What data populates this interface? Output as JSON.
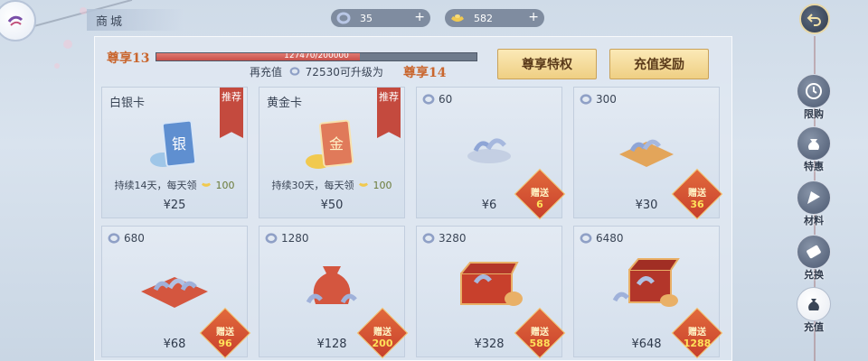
{
  "header": {
    "shop_title": "商城",
    "currencies": [
      {
        "name": "jade-ring-icon",
        "value": "35",
        "add_label": "+"
      },
      {
        "name": "gold-ingot-icon",
        "value": "582",
        "add_label": "+"
      }
    ]
  },
  "vip": {
    "current_level": "尊享13",
    "next_level": "尊享14",
    "progress_text": "127470/200000",
    "progress_fraction": 0.637,
    "recharge_prefix": "再充值",
    "recharge_amount": "72530",
    "recharge_suffix": "可升级为",
    "privilege_button": "尊享特权",
    "reward_button": "充值奖励"
  },
  "cards": [
    {
      "title": "白银卡",
      "tag": "推荐",
      "art_char": "银",
      "desc_prefix": "持续14天，每天领",
      "desc_value": "100",
      "price": "¥25"
    },
    {
      "title": "黄金卡",
      "tag": "推荐",
      "art_char": "金",
      "desc_prefix": "持续30天，每天领",
      "desc_value": "100",
      "price": "¥50"
    },
    {
      "amount": "60",
      "price": "¥6",
      "gift_label": "赠送",
      "gift_value": "6"
    },
    {
      "amount": "300",
      "price": "¥30",
      "gift_label": "赠送",
      "gift_value": "36"
    },
    {
      "amount": "680",
      "price": "¥68",
      "gift_label": "赠送",
      "gift_value": "96"
    },
    {
      "amount": "1280",
      "price": "¥128",
      "gift_label": "赠送",
      "gift_value": "200"
    },
    {
      "amount": "3280",
      "price": "¥328",
      "gift_label": "赠送",
      "gift_value": "588"
    },
    {
      "amount": "6480",
      "price": "¥648",
      "gift_label": "赠送",
      "gift_value": "1288"
    }
  ],
  "side_nav": [
    {
      "label": "限购",
      "icon": "clock-icon"
    },
    {
      "label": "特惠",
      "icon": "pouch-icon"
    },
    {
      "label": "材料",
      "icon": "fan-icon"
    },
    {
      "label": "兑换",
      "icon": "ticket-icon"
    },
    {
      "label": "充值",
      "icon": "money-bag-icon",
      "active": true
    }
  ],
  "colors": {
    "accent_red": "#c44a3e",
    "gold": "#efcf83",
    "panel": "#e2e9f2"
  }
}
